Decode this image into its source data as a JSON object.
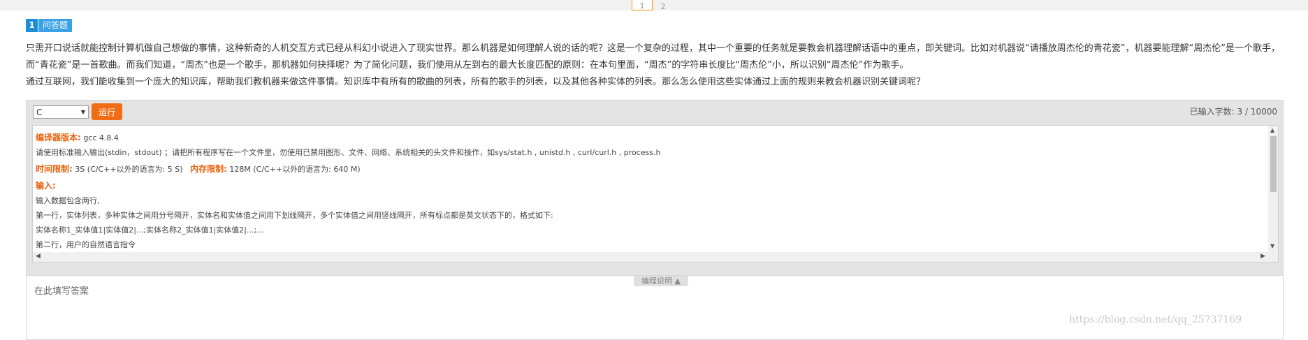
{
  "pagination": {
    "pages": [
      "1",
      "2"
    ],
    "active": "1"
  },
  "question": {
    "number": "1",
    "type": "问答题",
    "paragraphs": [
      "只需开口说话就能控制计算机做自己想做的事情，这种新奇的人机交互方式已经从科幻小说进入了现实世界。那么机器是如何理解人说的话的呢？这是一个复杂的过程，其中一个重要的任务就是要教会机器理解话语中的重点，即关键词。比如对机器说“请播放周杰伦的青花瓷”，机器要能理解“周杰伦”是一个歌手，而“青花瓷”是一首歌曲。而我们知道，“周杰”也是一个歌手，那机器如何抉择呢？为了简化问题，我们使用从左到右的最大长度匹配的原则：在本句里面，“周杰”的字符串长度比“周杰伦”小，所以识别“周杰伦”作为歌手。",
      "通过互联网，我们能收集到一个庞大的知识库，帮助我们教机器来做这件事情。知识库中有所有的歌曲的列表，所有的歌手的列表，以及其他各种实体的列表。那么怎么使用这些实体通过上面的规则来教会机器识别关键词呢？"
    ]
  },
  "editor": {
    "language": "C",
    "run_label": "运行",
    "char_count": "已输入字数: 3 / 10000"
  },
  "info": {
    "compiler_label": "编译器版本:",
    "compiler_value": "gcc 4.8.4",
    "io_note": "请使用标准输入输出(stdin，stdout) ；请把所有程序写在一个文件里，勿使用已禁用图形、文件、网络、系统相关的头文件和操作，如sys/stat.h , unistd.h , curl/curl.h , process.h",
    "time_label": "时间限制:",
    "time_value": "3S (C/C++以外的语言为: 5 S)",
    "mem_label": "内存限制:",
    "mem_value": "128M (C/C++以外的语言为: 640 M)",
    "input_label": "输入:",
    "input_lines": [
      "输入数据包含两行,",
      "第一行，实体列表，多种实体之间用分号隔开，实体名和实体值之间用下划线隔开，多个实体值之间用竖线隔开，所有标点都是英文状态下的，格式如下:",
      "实体名称1_实体值1|实体值2|...;实体名称2_实体值1|实体值2|...;...",
      "第二行，用户的自然语言指令"
    ]
  },
  "toggle_label": "编程说明 ▲",
  "answer_placeholder": "在此填写答案",
  "watermark": "https://blog.csdn.net/qq_25737169",
  "colors": {
    "accent_orange": "#f16d14",
    "label_orange": "#e8620c",
    "badge_blue": "#1a8fd8"
  }
}
